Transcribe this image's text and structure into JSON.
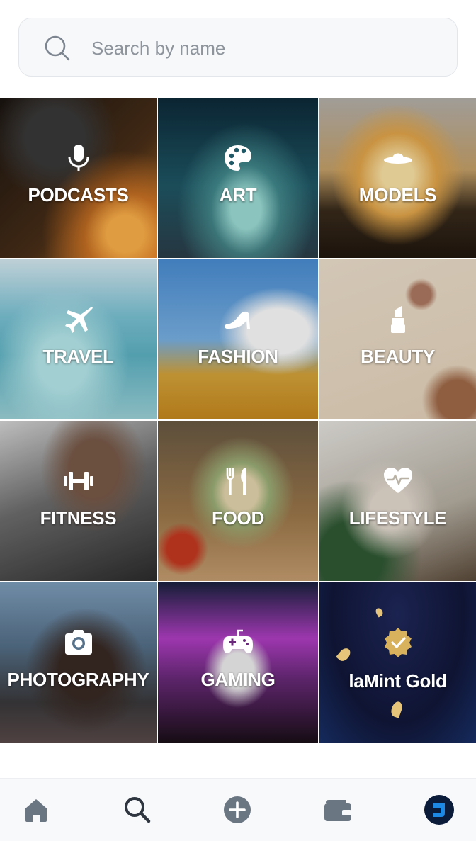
{
  "search": {
    "placeholder": "Search by name",
    "icon": "search-icon"
  },
  "categories": [
    {
      "label": "PODCASTS",
      "icon": "microphone-icon"
    },
    {
      "label": "ART",
      "icon": "palette-icon"
    },
    {
      "label": "MODELS",
      "icon": "sun-hat-icon"
    },
    {
      "label": "TRAVEL",
      "icon": "airplane-icon"
    },
    {
      "label": "FASHION",
      "icon": "high-heel-icon"
    },
    {
      "label": "BEAUTY",
      "icon": "lipstick-icon"
    },
    {
      "label": "FITNESS",
      "icon": "dumbbell-icon"
    },
    {
      "label": "FOOD",
      "icon": "fork-knife-icon"
    },
    {
      "label": "LIFESTYLE",
      "icon": "heart-pulse-icon"
    },
    {
      "label": "PHOTOGRAPHY",
      "icon": "camera-icon"
    },
    {
      "label": "GAMING",
      "icon": "gamepad-icon"
    },
    {
      "label": "laMint Gold",
      "icon": "gold-badge-icon"
    }
  ],
  "nav": [
    {
      "icon": "home-icon",
      "color": "#6b7683"
    },
    {
      "icon": "search-icon",
      "color": "#2f3640"
    },
    {
      "icon": "add-icon",
      "color": "#6b7683"
    },
    {
      "icon": "wallet-icon",
      "color": "#6b7683"
    },
    {
      "icon": "profile-icon",
      "color": "#1565c0"
    }
  ],
  "colors": {
    "gold": "#d9b25e",
    "accent": "#1565c0"
  }
}
